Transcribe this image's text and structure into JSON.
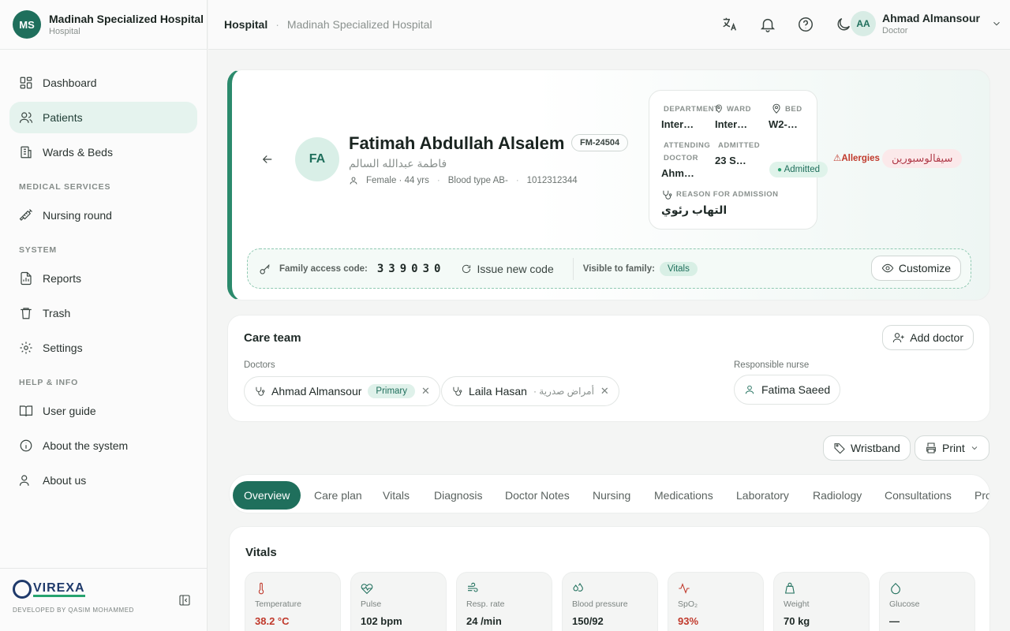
{
  "sidebar": {
    "logo_initials": "MS",
    "hospital_name": "Madinah Specialized Hospital",
    "hospital_sub": "Hospital",
    "items": [
      {
        "label": "Dashboard"
      },
      {
        "label": "Patients"
      },
      {
        "label": "Wards & Beds"
      }
    ],
    "sections": [
      {
        "title": "MEDICAL SERVICES",
        "items": [
          {
            "label": "Nursing round"
          }
        ]
      },
      {
        "title": "SYSTEM",
        "items": [
          {
            "label": "Reports"
          },
          {
            "label": "Trash"
          },
          {
            "label": "Settings"
          }
        ]
      },
      {
        "title": "HELP & INFO",
        "items": [
          {
            "label": "User guide"
          },
          {
            "label": "About the system"
          },
          {
            "label": "About us"
          }
        ]
      }
    ],
    "footer_brand": "VIREXA",
    "footer_credit": "DEVELOPED BY QASIM MOHAMMED"
  },
  "topbar": {
    "crumb_root": "Hospital",
    "crumb_current": "Madinah Specialized Hospital",
    "user_initials": "AA",
    "user_name": "Ahmad Almansour",
    "user_role": "Doctor"
  },
  "patient": {
    "initials": "FA",
    "name": "Fatimah Abdullah Alsalem",
    "mrn": "FM-24504",
    "name_arabic": "فاطمة عبدالله السالم",
    "gender_age": "Female · 44 yrs",
    "blood_type": "Blood type AB-",
    "national_id": "1012312344",
    "admission": {
      "department_label": "DEPARTMENT",
      "department_value": "Inter…",
      "ward_label": "WARD",
      "ward_value": "Inter…",
      "bed_label": "BED",
      "bed_value": "W2-…",
      "attending_label_1": "ATTENDING",
      "attending_label_2": "DOCTOR",
      "attending_value": "Ahm…",
      "admitted_label": "ADMITTED",
      "admitted_value": "23 S…",
      "reason_label": "REASON FOR ADMISSION",
      "reason_value": "التهاب رئوي"
    },
    "status": "Admitted",
    "allergy_label": "Allergies",
    "allergy_value": "سيفالوسبورين"
  },
  "family_access": {
    "label": "Family access code:",
    "code": "339030",
    "issue_label": "Issue new code",
    "visible_label": "Visible to family:",
    "visible_chip": "Vitals",
    "customize_label": "Customize"
  },
  "care_team": {
    "title": "Care team",
    "add_label": "Add doctor",
    "doctors_label": "Doctors",
    "nurse_label": "Responsible nurse",
    "doctors": [
      {
        "name": "Ahmad Almansour",
        "badge": "Primary"
      },
      {
        "name": "Laila Hasan",
        "specialty": "· أمراض صدرية"
      }
    ],
    "nurse": "Fatima Saeed",
    "remove_symbol": "✕"
  },
  "actions": {
    "wristband": "Wristband",
    "print": "Print"
  },
  "tabs": [
    "Overview",
    "Care plan",
    "Vitals",
    "Diagnosis",
    "Doctor Notes",
    "Nursing",
    "Medications",
    "Laboratory",
    "Radiology",
    "Consultations",
    "Pro"
  ],
  "vitals": {
    "title": "Vitals",
    "items": [
      {
        "label": "Temperature",
        "value": "38.2 °C",
        "alert": true
      },
      {
        "label": "Pulse",
        "value": "102 bpm",
        "alert": false
      },
      {
        "label": "Resp. rate",
        "value": "24 /min",
        "alert": false
      },
      {
        "label": "Blood pressure",
        "value": "150/92",
        "alert": false
      },
      {
        "label": "SpO₂",
        "value": "93%",
        "alert": true
      },
      {
        "label": "Weight",
        "value": "70 kg",
        "alert": false
      },
      {
        "label": "Glucose",
        "value": "—",
        "alert": false
      }
    ]
  },
  "colors": {
    "accent": "#1f6f5c",
    "alert": "#c0392b",
    "mint": "#e5f3ee"
  }
}
